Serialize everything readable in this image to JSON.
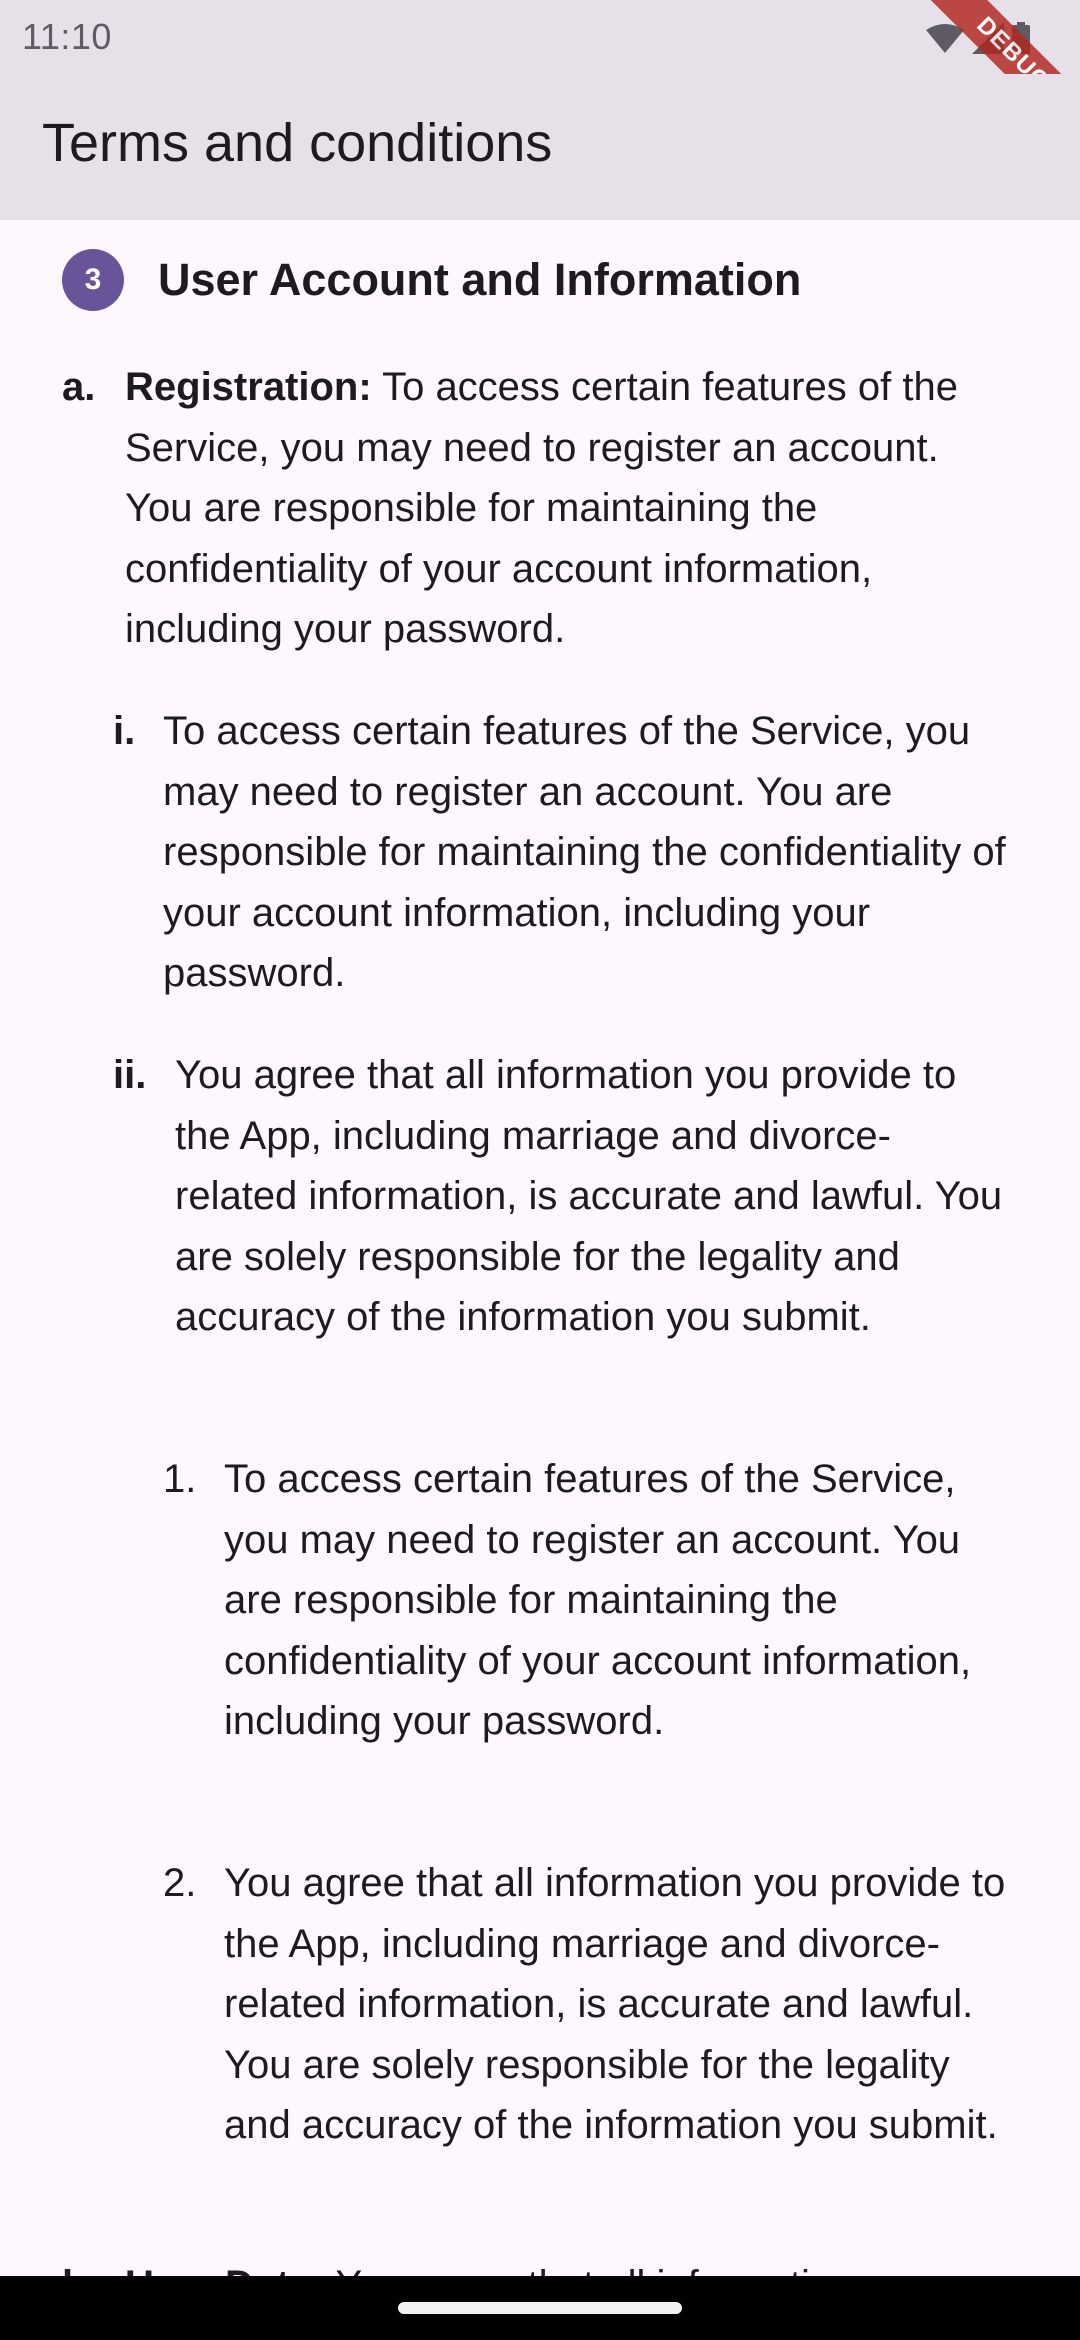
{
  "status_bar": {
    "time": "11:10",
    "icons": [
      "wifi-icon",
      "signal-icon",
      "battery-icon"
    ]
  },
  "debug_banner": "DEBUG",
  "app_bar": {
    "title": "Terms and conditions"
  },
  "section": {
    "number": "3",
    "title": "User Account and Information"
  },
  "items": [
    {
      "marker": "a.",
      "label": "Registration:",
      "text": "To access certain features of the Service, you may need to register an account. You are responsible for maintaining the confidentiality of your account information, including your password."
    },
    {
      "marker": "i.",
      "text": "To access certain features of the Service, you may need to register an account. You are responsible for maintaining the confidentiality of your account information, including your password."
    },
    {
      "marker": "ii.",
      "text": "You agree that all information you provide to the App, including marriage and divorce-related information, is accurate and lawful. You are solely responsible for the legality and accuracy of the information you submit."
    },
    {
      "marker": "1.",
      "text": "To access certain features of the Service, you may need to register an account. You are responsible for maintaining the confidentiality of your account information, including your password."
    },
    {
      "marker": "2.",
      "text": "You agree that all information you provide to the App, including marriage and divorce-related information, is accurate and lawful. You are solely responsible for the legality and accuracy of the information you submit."
    },
    {
      "marker": "b.",
      "label": "User Data:",
      "text": "You agree that all information"
    }
  ],
  "colors": {
    "app_bar_background": "#e6e0e9",
    "page_background": "#fef7ff",
    "badge": "#6a5499",
    "text": "#1d1b20"
  }
}
